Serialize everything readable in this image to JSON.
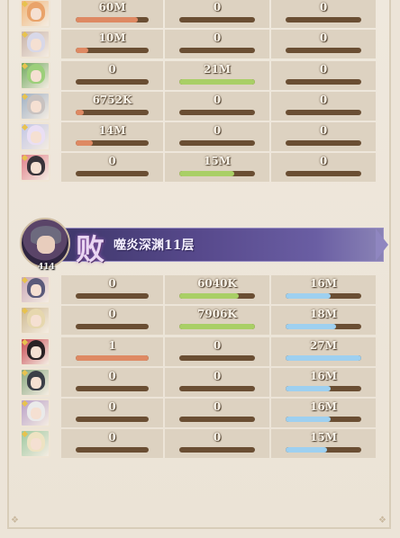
{
  "team1": {
    "rows": [
      {
        "hero": "hero-1",
        "c1": {
          "value": "60M",
          "fill": 0.85,
          "color": "orange"
        },
        "c2": {
          "value": "0",
          "fill": 0,
          "color": "green"
        },
        "c3": {
          "value": "0",
          "fill": 0,
          "color": "blue"
        }
      },
      {
        "hero": "hero-2",
        "c1": {
          "value": "10M",
          "fill": 0.17,
          "color": "orange"
        },
        "c2": {
          "value": "0",
          "fill": 0,
          "color": "green"
        },
        "c3": {
          "value": "0",
          "fill": 0,
          "color": "blue"
        }
      },
      {
        "hero": "hero-3",
        "c1": {
          "value": "0",
          "fill": 0,
          "color": "orange"
        },
        "c2": {
          "value": "21M",
          "fill": 1.0,
          "color": "green"
        },
        "c3": {
          "value": "0",
          "fill": 0,
          "color": "blue"
        }
      },
      {
        "hero": "hero-4",
        "c1": {
          "value": "6752K",
          "fill": 0.11,
          "color": "orange"
        },
        "c2": {
          "value": "0",
          "fill": 0,
          "color": "green"
        },
        "c3": {
          "value": "0",
          "fill": 0,
          "color": "blue"
        }
      },
      {
        "hero": "hero-5",
        "c1": {
          "value": "14M",
          "fill": 0.23,
          "color": "orange"
        },
        "c2": {
          "value": "0",
          "fill": 0,
          "color": "green"
        },
        "c3": {
          "value": "0",
          "fill": 0,
          "color": "blue"
        }
      },
      {
        "hero": "hero-6",
        "c1": {
          "value": "0",
          "fill": 0,
          "color": "orange"
        },
        "c2": {
          "value": "15M",
          "fill": 0.73,
          "color": "green"
        },
        "c3": {
          "value": "0",
          "fill": 0,
          "color": "blue"
        }
      }
    ]
  },
  "battle": {
    "result": "败",
    "stage": "噬炎深渊11层",
    "boss_level": "414"
  },
  "team2": {
    "rows": [
      {
        "hero": "hero-7",
        "c1": {
          "value": "0",
          "fill": 0,
          "color": "orange"
        },
        "c2": {
          "value": "6040K",
          "fill": 0.78,
          "color": "green"
        },
        "c3": {
          "value": "16M",
          "fill": 0.59,
          "color": "blue"
        }
      },
      {
        "hero": "hero-8",
        "c1": {
          "value": "0",
          "fill": 0,
          "color": "orange"
        },
        "c2": {
          "value": "7906K",
          "fill": 1.0,
          "color": "green"
        },
        "c3": {
          "value": "18M",
          "fill": 0.67,
          "color": "blue"
        }
      },
      {
        "hero": "hero-9",
        "c1": {
          "value": "1",
          "fill": 1.0,
          "color": "orange"
        },
        "c2": {
          "value": "0",
          "fill": 0,
          "color": "green"
        },
        "c3": {
          "value": "27M",
          "fill": 1.0,
          "color": "blue"
        }
      },
      {
        "hero": "hero-10",
        "c1": {
          "value": "0",
          "fill": 0,
          "color": "orange"
        },
        "c2": {
          "value": "0",
          "fill": 0,
          "color": "green"
        },
        "c3": {
          "value": "16M",
          "fill": 0.59,
          "color": "blue"
        }
      },
      {
        "hero": "hero-11",
        "c1": {
          "value": "0",
          "fill": 0,
          "color": "orange"
        },
        "c2": {
          "value": "0",
          "fill": 0,
          "color": "green"
        },
        "c3": {
          "value": "16M",
          "fill": 0.59,
          "color": "blue"
        }
      },
      {
        "hero": "hero-12",
        "c1": {
          "value": "0",
          "fill": 0,
          "color": "orange"
        },
        "c2": {
          "value": "0",
          "fill": 0,
          "color": "green"
        },
        "c3": {
          "value": "15M",
          "fill": 0.55,
          "color": "blue"
        }
      }
    ]
  },
  "colors": {
    "orange": "#de8963",
    "green": "#a9cf66",
    "blue": "#9ed0f0",
    "bar_track": "#6a4e33"
  }
}
